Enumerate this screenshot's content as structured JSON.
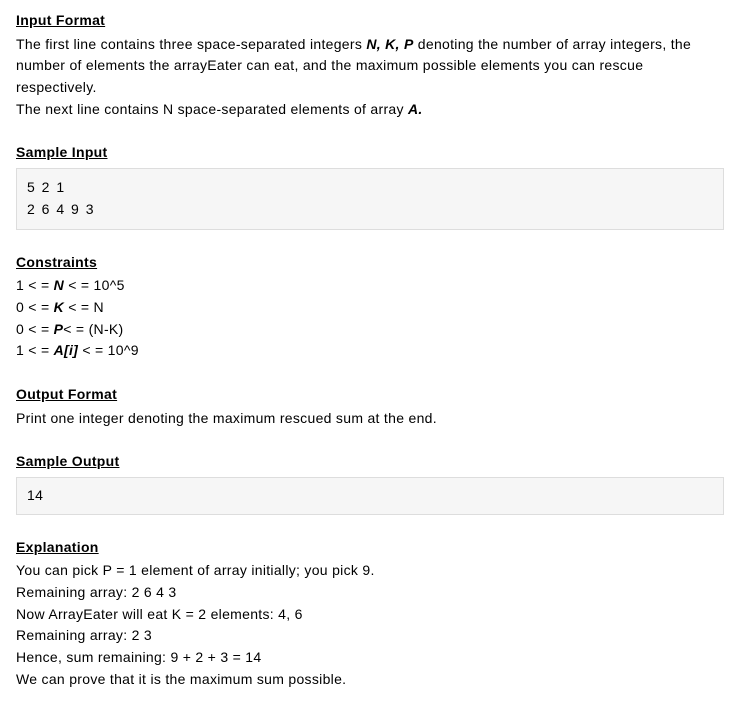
{
  "input_format": {
    "heading": "Input Format",
    "line1_a": "The first line contains three space-separated integers ",
    "line1_vars": "N, K, P",
    "line1_b": " denoting the number of array integers, the number of elements the arrayEater can eat, and the maximum possible elements you can rescue respectively.",
    "line2_a": "The next line contains N space-separated elements of array ",
    "line2_var": "A."
  },
  "sample_input": {
    "heading": "Sample Input",
    "content": "5 2 1\n2 6 4 9 3"
  },
  "constraints": {
    "heading": "Constraints",
    "c1_pre": "1 < = ",
    "c1_var": "N",
    "c1_post": " < = 10^5",
    "c2_pre": "0 < = ",
    "c2_var": "K",
    "c2_post": " < = N",
    "c3_pre": "0 < = ",
    "c3_var": "P",
    "c3_post": "< = (N-K)",
    "c4_pre": "1 < = ",
    "c4_var": "A[i]",
    "c4_post": " < = 10^9"
  },
  "output_format": {
    "heading": "Output Format",
    "text": "Print one integer denoting the maximum rescued sum at the end."
  },
  "sample_output": {
    "heading": "Sample Output",
    "content": "14"
  },
  "explanation": {
    "heading": "Explanation",
    "l1": "You can pick P = 1 element of array initially; you pick 9.",
    "l2": "Remaining array: 2 6 4 3",
    "l3": "Now ArrayEater will eat K = 2 elements: 4, 6",
    "l4": "Remaining array: 2 3",
    "l5": "Hence, sum remaining: 9 + 2 + 3 = 14",
    "l6": "We can prove that it is the maximum sum possible."
  }
}
